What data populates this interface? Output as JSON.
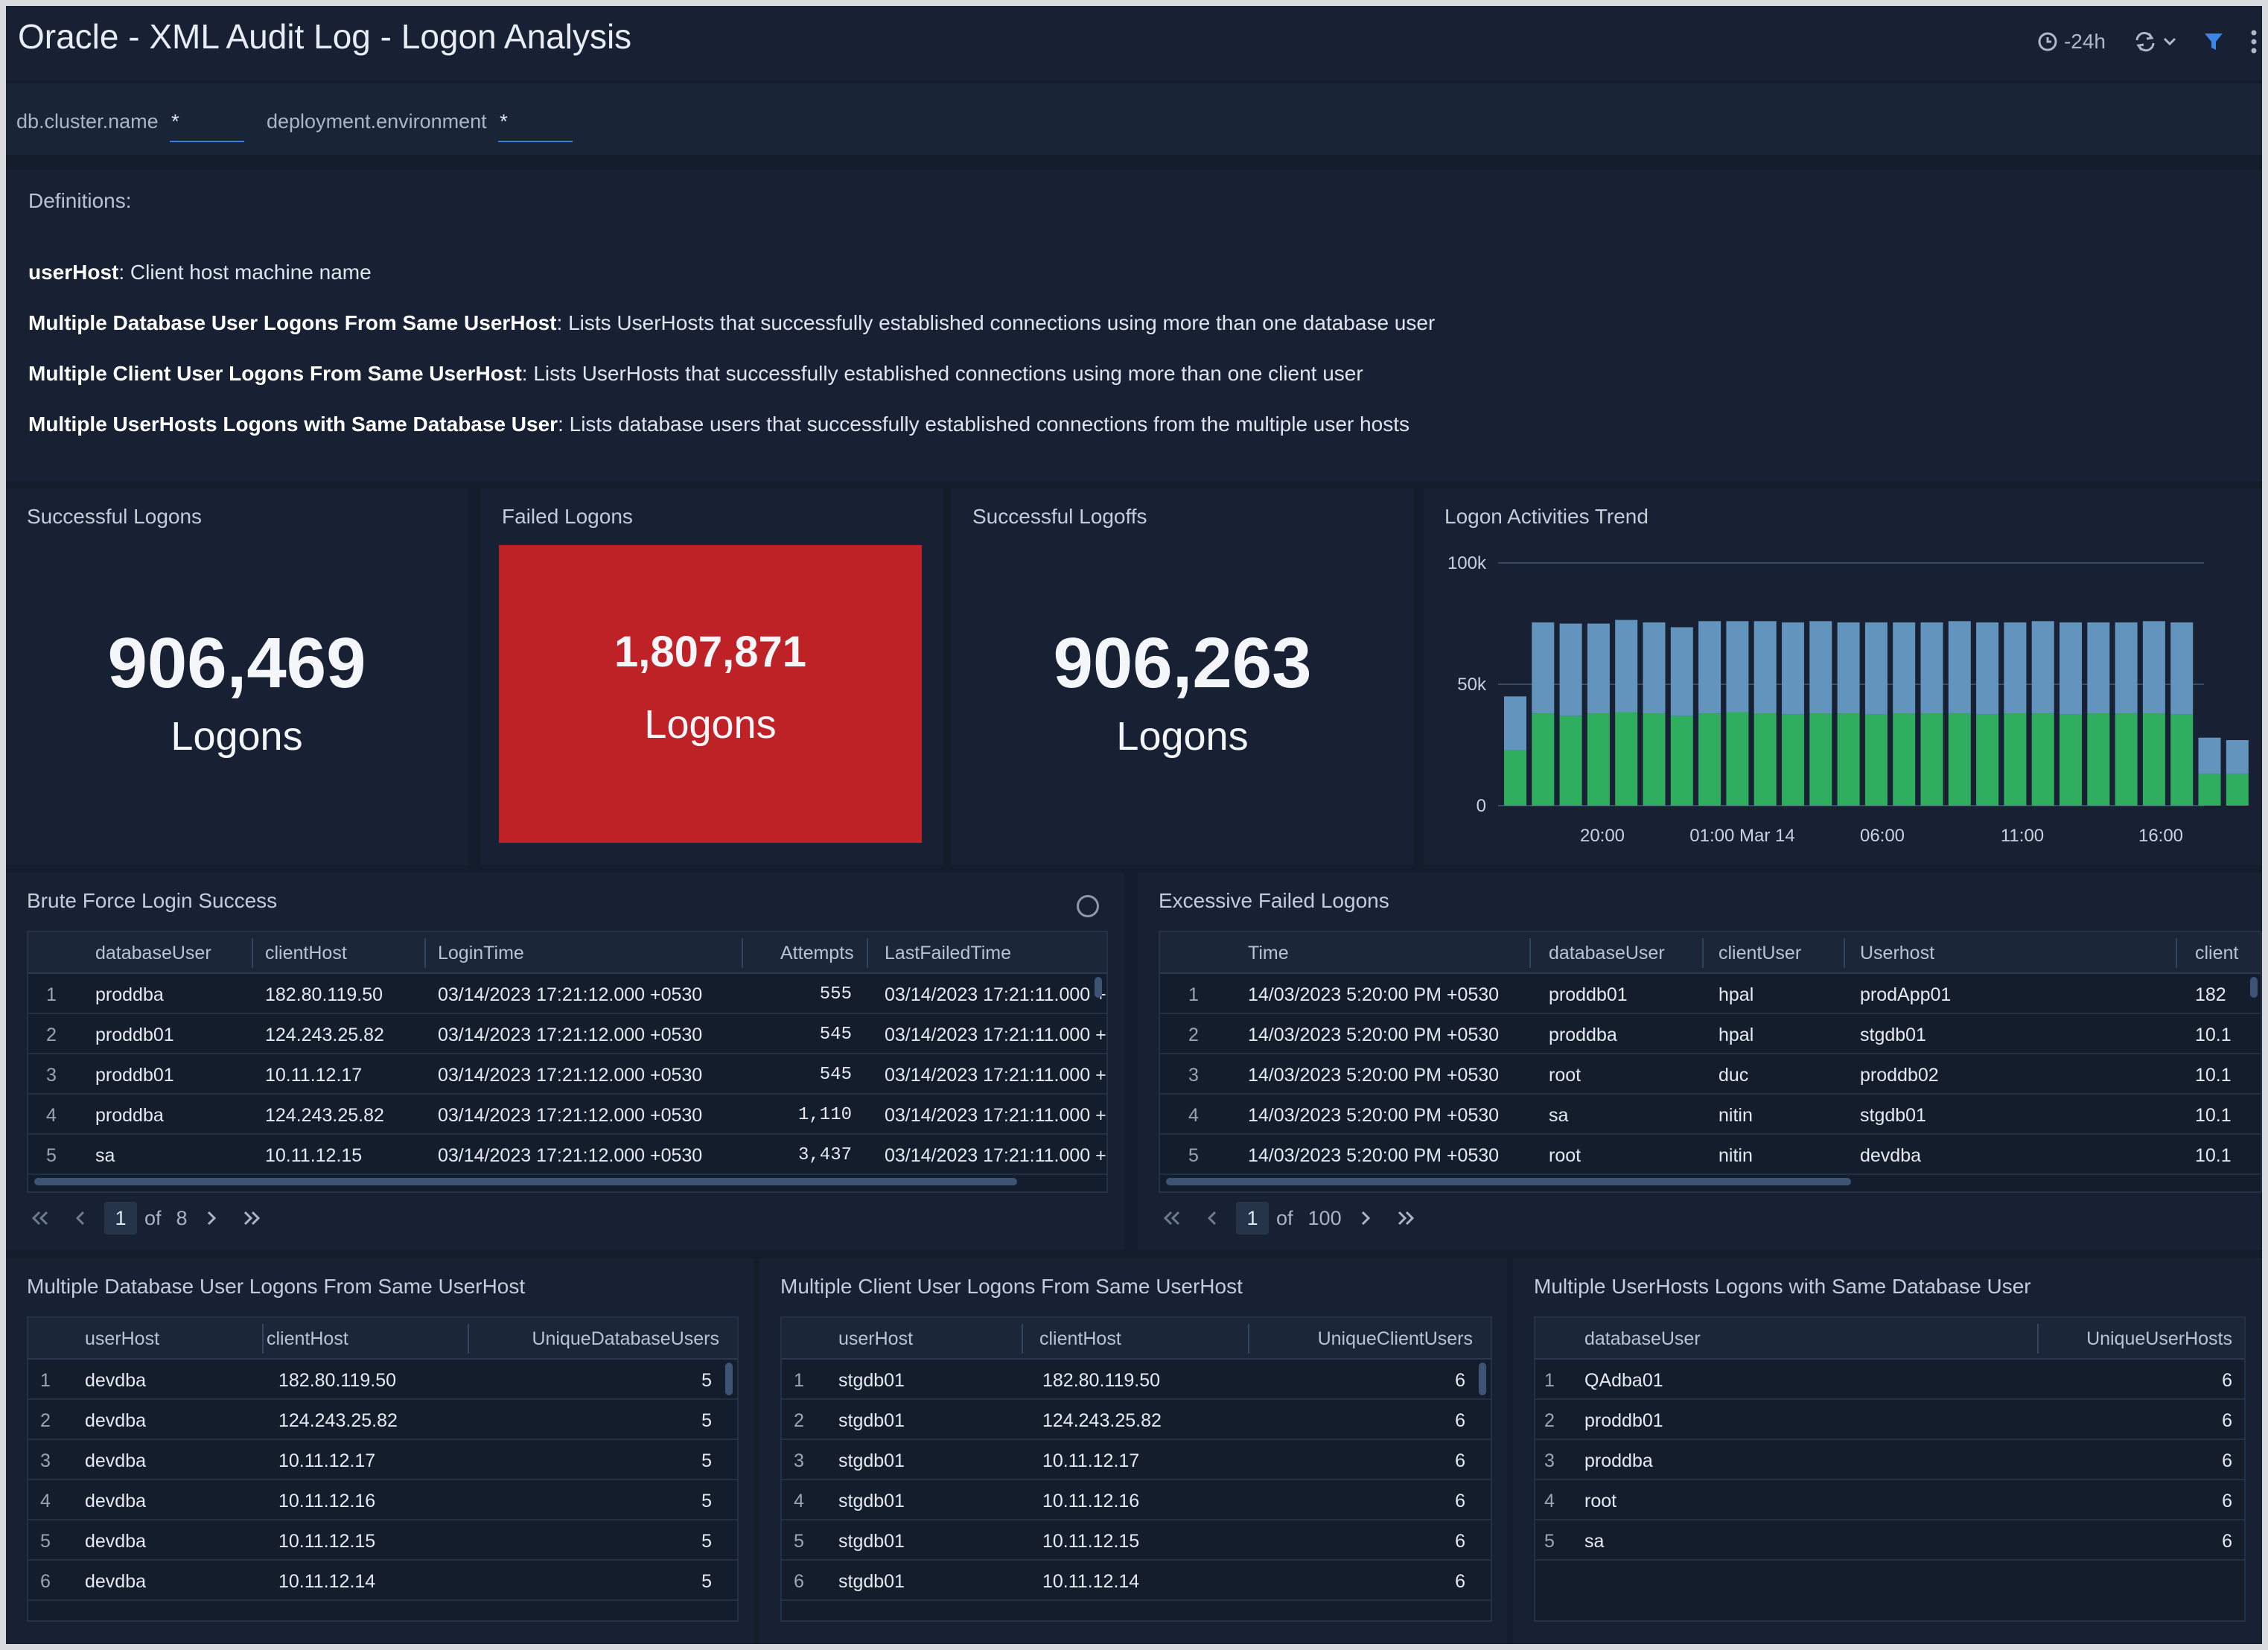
{
  "header": {
    "title": "Oracle - XML Audit Log - Logon Analysis",
    "time_range": "-24h"
  },
  "filters": [
    {
      "label": "db.cluster.name",
      "value": "*"
    },
    {
      "label": "deployment.environment",
      "value": "*"
    }
  ],
  "definitions": {
    "title": "Definitions:",
    "items": [
      {
        "term": "userHost",
        "text": ": Client host machine name"
      },
      {
        "term": "Multiple Database User Logons From Same UserHost",
        "text": ": Lists UserHosts that successfully established connections using more than one database user"
      },
      {
        "term": "Multiple Client User Logons From Same UserHost",
        "text": ": Lists UserHosts that successfully established connections using more than one client user"
      },
      {
        "term": "Multiple UserHosts Logons with Same Database User",
        "text": ": Lists database users that successfully established connections from the multiple user hosts"
      }
    ]
  },
  "stats": {
    "successful_logons": {
      "title": "Successful Logons",
      "value": "906,469",
      "unit": "Logons"
    },
    "failed_logons": {
      "title": "Failed Logons",
      "value": "1,807,871",
      "unit": "Logons",
      "color": "#bf2226"
    },
    "successful_logoffs": {
      "title": "Successful Logoffs",
      "value": "906,263",
      "unit": "Logons"
    }
  },
  "chart_data": {
    "type": "bar",
    "stacked": true,
    "title": "Logon Activities Trend",
    "x_tick_labels": [
      "20:00",
      "01:00 Mar 14",
      "06:00",
      "11:00",
      "16:00"
    ],
    "y_tick_labels": [
      "0",
      "50k",
      "100k"
    ],
    "ylim": [
      0,
      100000
    ],
    "grid": true,
    "legend": "none",
    "colors": {
      "bottom": "#2fae5f",
      "top": "#6394bd"
    },
    "series": [
      {
        "values": [
          23000,
          38000,
          37000,
          38000,
          38500,
          38000,
          37000,
          38000,
          38500,
          38000,
          37500,
          38000,
          38000,
          37500,
          38000,
          38000,
          38000,
          37500,
          38000,
          38000,
          37500,
          38000,
          38000,
          38000,
          37500,
          13000,
          13000
        ]
      },
      {
        "values": [
          22000,
          37500,
          38000,
          37000,
          38000,
          37500,
          36500,
          38000,
          37500,
          38000,
          38000,
          38000,
          37500,
          38000,
          37500,
          37500,
          38000,
          38000,
          37500,
          38000,
          38000,
          37500,
          37500,
          38000,
          38000,
          15000,
          14000
        ]
      }
    ]
  },
  "brute_force": {
    "title": "Brute Force Login Success",
    "columns": [
      "databaseUser",
      "clientHost",
      "LoginTime",
      "Attempts",
      "LastFailedTime"
    ],
    "rows": [
      {
        "i": "1",
        "databaseUser": "proddba",
        "clientHost": "182.80.119.50",
        "LoginTime": "03/14/2023 17:21:12.000 +0530",
        "Attempts": "555",
        "LastFailedTime": "03/14/2023 17:21:11.000 +"
      },
      {
        "i": "2",
        "databaseUser": "proddb01",
        "clientHost": "124.243.25.82",
        "LoginTime": "03/14/2023 17:21:12.000 +0530",
        "Attempts": "545",
        "LastFailedTime": "03/14/2023 17:21:11.000 +"
      },
      {
        "i": "3",
        "databaseUser": "proddb01",
        "clientHost": "10.11.12.17",
        "LoginTime": "03/14/2023 17:21:12.000 +0530",
        "Attempts": "545",
        "LastFailedTime": "03/14/2023 17:21:11.000 +"
      },
      {
        "i": "4",
        "databaseUser": "proddba",
        "clientHost": "124.243.25.82",
        "LoginTime": "03/14/2023 17:21:12.000 +0530",
        "Attempts": "1,110",
        "LastFailedTime": "03/14/2023 17:21:11.000 +"
      },
      {
        "i": "5",
        "databaseUser": "sa",
        "clientHost": "10.11.12.15",
        "LoginTime": "03/14/2023 17:21:12.000 +0530",
        "Attempts": "3,437",
        "LastFailedTime": "03/14/2023 17:21:11.000 +"
      }
    ],
    "pager": {
      "page": "1",
      "of": "of",
      "total": "8"
    }
  },
  "excessive_failed": {
    "title": "Excessive Failed Logons",
    "columns": [
      "Time",
      "databaseUser",
      "clientUser",
      "Userhost",
      "client"
    ],
    "rows": [
      {
        "i": "1",
        "Time": "14/03/2023 5:20:00 PM +0530",
        "databaseUser": "proddb01",
        "clientUser": "hpal",
        "Userhost": "prodApp01",
        "client": "182"
      },
      {
        "i": "2",
        "Time": "14/03/2023 5:20:00 PM +0530",
        "databaseUser": "proddba",
        "clientUser": "hpal",
        "Userhost": "stgdb01",
        "client": "10.1"
      },
      {
        "i": "3",
        "Time": "14/03/2023 5:20:00 PM +0530",
        "databaseUser": "root",
        "clientUser": "duc",
        "Userhost": "proddb02",
        "client": "10.1"
      },
      {
        "i": "4",
        "Time": "14/03/2023 5:20:00 PM +0530",
        "databaseUser": "sa",
        "clientUser": "nitin",
        "Userhost": "stgdb01",
        "client": "10.1"
      },
      {
        "i": "5",
        "Time": "14/03/2023 5:20:00 PM +0530",
        "databaseUser": "root",
        "clientUser": "nitin",
        "Userhost": "devdba",
        "client": "10.1"
      }
    ],
    "pager": {
      "page": "1",
      "of": "of",
      "total": "100"
    }
  },
  "multi_db_user": {
    "title": "Multiple Database User Logons From Same UserHost",
    "columns": [
      "userHost",
      "clientHost",
      "UniqueDatabaseUsers"
    ],
    "rows": [
      {
        "i": "1",
        "userHost": "devdba",
        "clientHost": "182.80.119.50",
        "count": "5"
      },
      {
        "i": "2",
        "userHost": "devdba",
        "clientHost": "124.243.25.82",
        "count": "5"
      },
      {
        "i": "3",
        "userHost": "devdba",
        "clientHost": "10.11.12.17",
        "count": "5"
      },
      {
        "i": "4",
        "userHost": "devdba",
        "clientHost": "10.11.12.16",
        "count": "5"
      },
      {
        "i": "5",
        "userHost": "devdba",
        "clientHost": "10.11.12.15",
        "count": "5"
      },
      {
        "i": "6",
        "userHost": "devdba",
        "clientHost": "10.11.12.14",
        "count": "5"
      }
    ]
  },
  "multi_client_user": {
    "title": "Multiple Client User Logons From Same UserHost",
    "columns": [
      "userHost",
      "clientHost",
      "UniqueClientUsers"
    ],
    "rows": [
      {
        "i": "1",
        "userHost": "stgdb01",
        "clientHost": "182.80.119.50",
        "count": "6"
      },
      {
        "i": "2",
        "userHost": "stgdb01",
        "clientHost": "124.243.25.82",
        "count": "6"
      },
      {
        "i": "3",
        "userHost": "stgdb01",
        "clientHost": "10.11.12.17",
        "count": "6"
      },
      {
        "i": "4",
        "userHost": "stgdb01",
        "clientHost": "10.11.12.16",
        "count": "6"
      },
      {
        "i": "5",
        "userHost": "stgdb01",
        "clientHost": "10.11.12.15",
        "count": "6"
      },
      {
        "i": "6",
        "userHost": "stgdb01",
        "clientHost": "10.11.12.14",
        "count": "6"
      }
    ]
  },
  "multi_userhosts": {
    "title": "Multiple UserHosts Logons with Same Database User",
    "columns": [
      "databaseUser",
      "UniqueUserHosts"
    ],
    "rows": [
      {
        "i": "1",
        "databaseUser": "QAdba01",
        "count": "6"
      },
      {
        "i": "2",
        "databaseUser": "proddb01",
        "count": "6"
      },
      {
        "i": "3",
        "databaseUser": "proddba",
        "count": "6"
      },
      {
        "i": "4",
        "databaseUser": "root",
        "count": "6"
      },
      {
        "i": "5",
        "databaseUser": "sa",
        "count": "6"
      }
    ]
  }
}
